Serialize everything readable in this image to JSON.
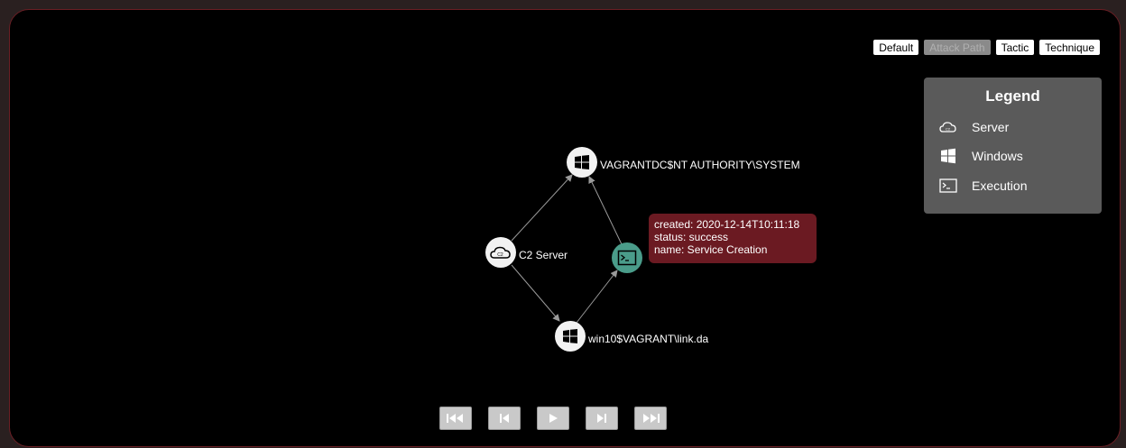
{
  "view_toggle": {
    "default": "Default",
    "attack_path": "Attack Path",
    "tactic": "Tactic",
    "technique": "Technique"
  },
  "legend": {
    "title": "Legend",
    "items": [
      {
        "icon": "cloud-c2-icon",
        "label": "Server"
      },
      {
        "icon": "windows-icon",
        "label": "Windows"
      },
      {
        "icon": "terminal-icon",
        "label": "Execution"
      }
    ]
  },
  "graph": {
    "nodes": [
      {
        "id": "c2",
        "type": "server",
        "label": "C2 Server"
      },
      {
        "id": "dc",
        "type": "windows",
        "label": "VAGRANTDC$NT AUTHORITY\\SYSTEM"
      },
      {
        "id": "win10",
        "type": "windows",
        "label": "win10$VAGRANT\\link.da"
      },
      {
        "id": "exec",
        "type": "execution",
        "label": ""
      }
    ],
    "edges": [
      {
        "from": "c2",
        "to": "dc"
      },
      {
        "from": "c2",
        "to": "win10"
      },
      {
        "from": "win10",
        "to": "exec"
      },
      {
        "from": "exec",
        "to": "dc"
      }
    ]
  },
  "tooltip": {
    "created": "created: 2020-12-14T10:11:18",
    "status": "status: success",
    "name": "name: Service Creation"
  },
  "controls": [
    "skip-to-start",
    "step-back",
    "play",
    "step-forward",
    "skip-to-end"
  ],
  "colors": {
    "background": "#000000",
    "frame_border": "#6b1f25",
    "tooltip": "#6b1a22",
    "execution_node": "#4a9c8a",
    "legend_bg": "#5a5a5a"
  }
}
